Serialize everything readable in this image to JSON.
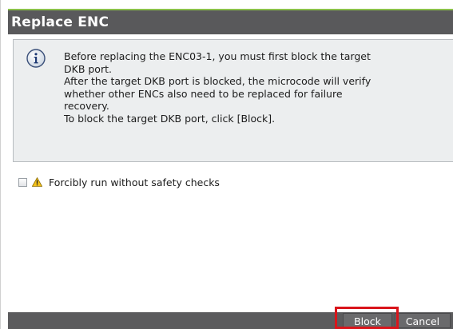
{
  "dialog": {
    "title": "Replace ENC"
  },
  "info": {
    "icon": "info-icon",
    "lines": [
      "Before replacing the ENC03-1, you must first block the target",
      "DKB port.",
      "After the target DKB port is blocked, the microcode will verify",
      "whether other ENCs also need to be replaced for failure",
      "recovery.",
      "To block the target DKB port, click [Block]."
    ]
  },
  "option": {
    "checkbox_checked": false,
    "icon": "warning-icon",
    "label": "Forcibly run without safety checks"
  },
  "buttons": {
    "block_label": "Block",
    "cancel_label": "Cancel"
  },
  "colors": {
    "title_bar": "#59595b",
    "title_accent": "#8bc14a",
    "info_panel": "#eceeef",
    "footer": "#5b5b5d",
    "highlight": "#d9151b"
  }
}
